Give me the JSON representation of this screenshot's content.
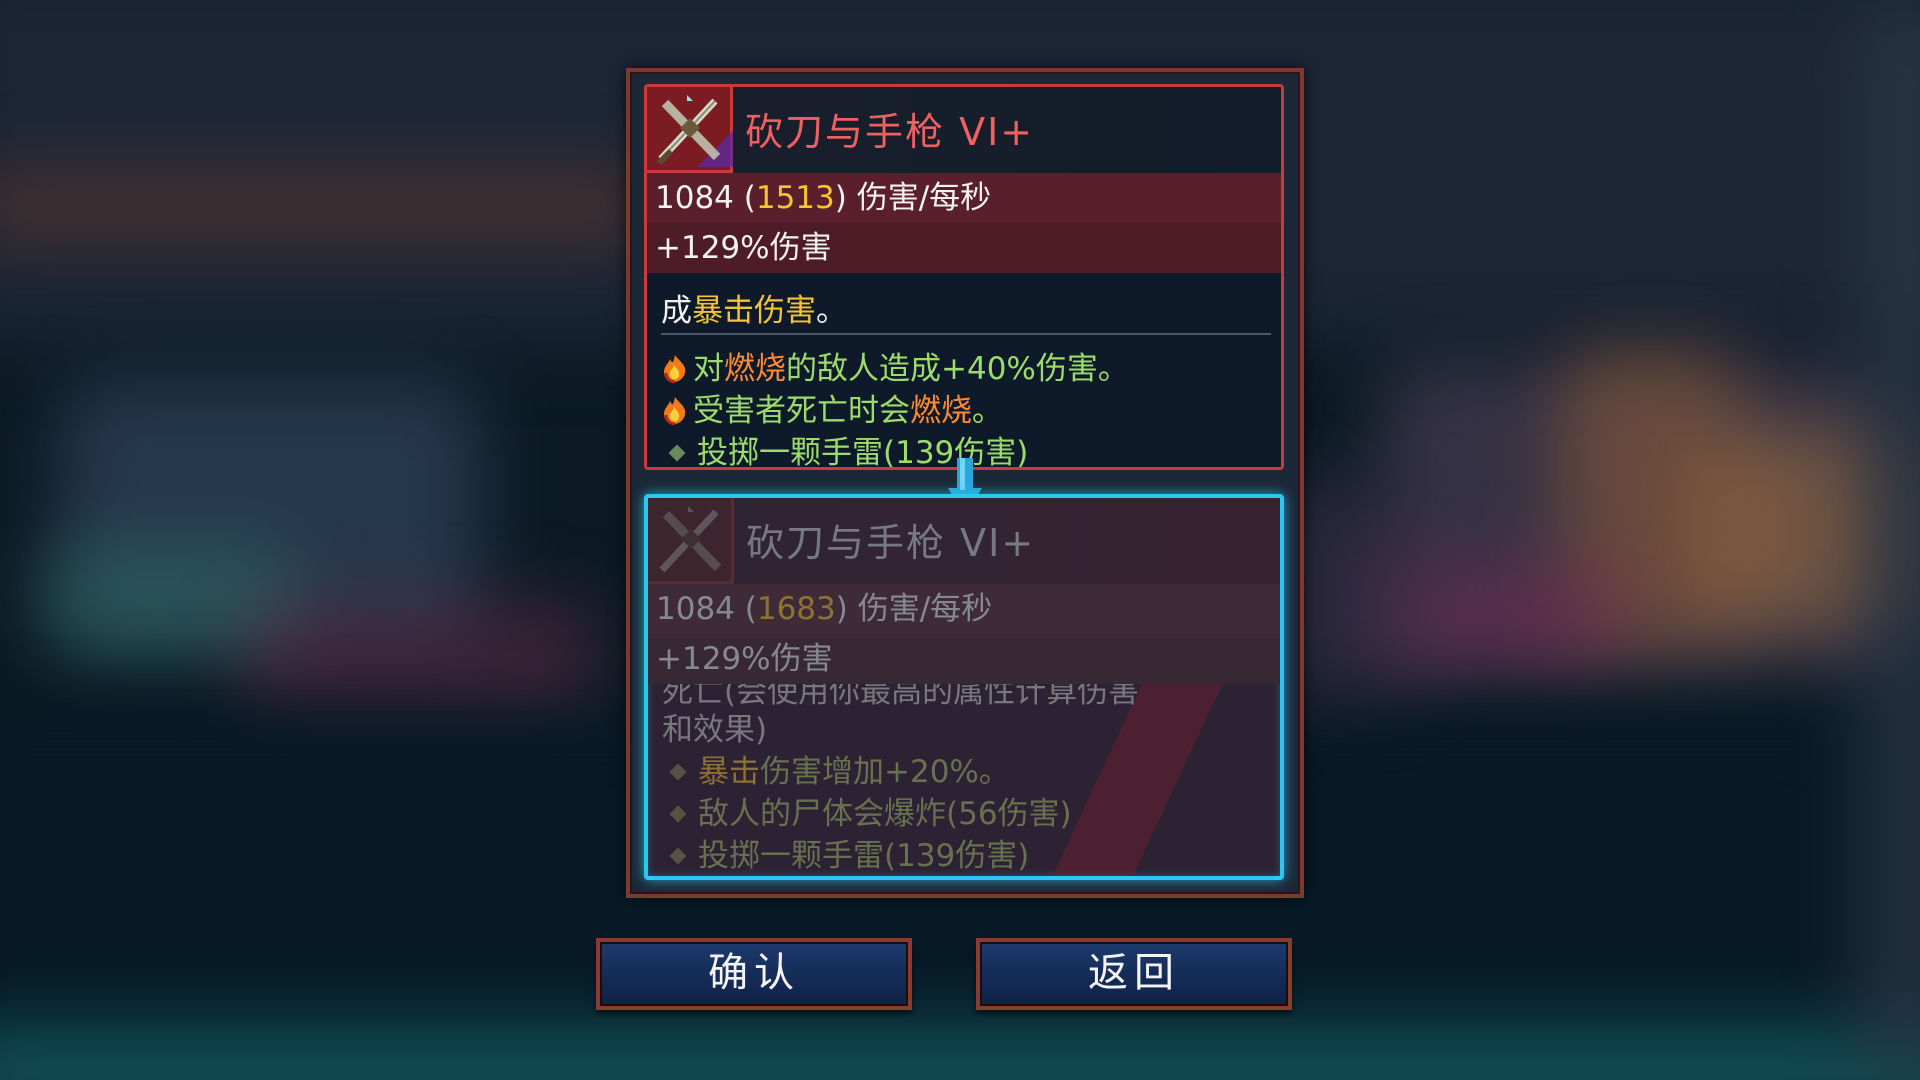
{
  "current_item": {
    "name": "砍刀与手枪 VI+",
    "dps_base": "1084",
    "dps_bonus": "1513",
    "dps_unit": "伤害/每秒",
    "damage_bonus": "+129%伤害",
    "partial_line_prefix": "成",
    "partial_line_keyword": "暴击伤害",
    "partial_line_suffix": "。",
    "effects": {
      "e1_pre": "对",
      "e1_kw": "燃烧",
      "e1_post": "的敌人造成+40%伤害。",
      "e2_pre": "受害者死亡时会",
      "e2_kw": "燃烧",
      "e2_post": "。",
      "e3": "投掷一颗手雷(139伤害)"
    }
  },
  "new_item": {
    "name": "砍刀与手枪 VI+",
    "dps_base": "1084",
    "dps_bonus": "1683",
    "dps_unit": "伤害/每秒",
    "damage_bonus": "+129%伤害",
    "cut_line": "死亡(会使用你最高的属性计算伤害",
    "partial_line": "和效果)",
    "effects": {
      "e1_kw": "暴击",
      "e1_post": "伤害增加+20%。",
      "e2": "敌人的尸体会爆炸(56伤害)",
      "e3": "投掷一颗手雷(139伤害)"
    }
  },
  "buttons": {
    "confirm": "确认",
    "back": "返回"
  },
  "colors": {
    "card_border_current": "#c93a3c",
    "card_border_new": "#2cc7f2",
    "title_red": "#f06060",
    "bonus_gold": "#f4c531",
    "effect_green": "#9ddc6a",
    "burn_orange": "#ff8a30",
    "button_blue": "#1d3a6e"
  },
  "icons": {
    "weapon": "crossed-blade-pistol-icon",
    "burn": "flame-icon",
    "bullet": "diamond-bullet-icon",
    "compare_arrow": "arrow-down-icon"
  }
}
